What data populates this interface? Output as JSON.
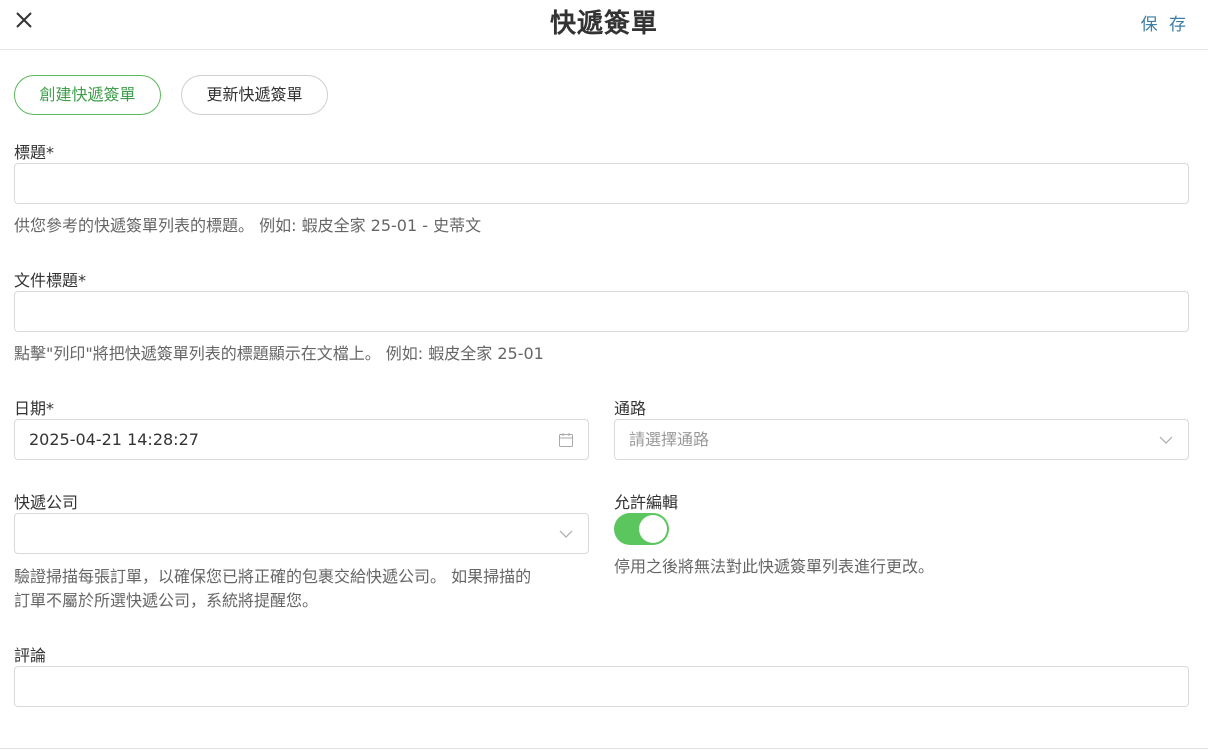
{
  "header": {
    "title": "快遞簽單",
    "save_label": "保 存"
  },
  "tabs": {
    "create_label": "創建快遞簽單",
    "update_label": "更新快遞簽單"
  },
  "form": {
    "title_field": {
      "label": "標題*",
      "value": "",
      "help": "供您參考的快遞簽單列表的標題。 例如: 蝦皮全家 25-01 - 史蒂文"
    },
    "doc_title_field": {
      "label": "文件標題*",
      "value": "",
      "help": "點擊\"列印\"將把快遞簽單列表的標題顯示在文檔上。 例如: 蝦皮全家 25-01"
    },
    "date_field": {
      "label": "日期*",
      "value": "2025-04-21 14:28:27"
    },
    "channel_field": {
      "label": "通路",
      "placeholder": "請選擇通路"
    },
    "courier_field": {
      "label": "快遞公司",
      "value": "",
      "help_line1": "驗證掃描每張訂單，以確保您已將正確的包裹交給快遞公司。 如果掃描的",
      "help_line2": "訂單不屬於所選快遞公司，系統將提醒您。"
    },
    "allow_edit_field": {
      "label": "允許編輯",
      "enabled": true,
      "help": "停用之後將無法對此快遞簽單列表進行更改。"
    },
    "comment_field": {
      "label": "評論",
      "value": ""
    }
  },
  "colors": {
    "accent_green": "#5cc65e",
    "save_blue": "#3d7ea6"
  }
}
